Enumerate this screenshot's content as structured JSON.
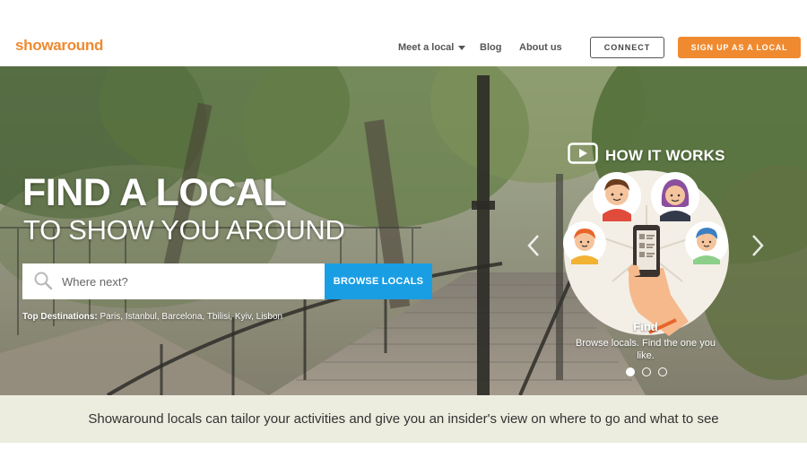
{
  "header": {
    "logo": "showaround",
    "nav": {
      "meet_label": "Meet a local",
      "blog_label": "Blog",
      "about_label": "About us"
    },
    "connect_label": "CONNECT",
    "signup_label": "SIGN UP AS A LOCAL"
  },
  "hero": {
    "title": "FIND A LOCAL",
    "subtitle": "TO SHOW YOU AROUND",
    "search": {
      "placeholder": "Where next?",
      "value": ""
    },
    "browse_label": "BROWSE LOCALS",
    "top_destinations": {
      "label": "Top Destinations:",
      "list": "Paris, Istanbul, Barcelona, Tbilisi, Kyiv, Lisbon"
    }
  },
  "how_it_works": {
    "title": "HOW IT WORKS",
    "step_title": "Find",
    "step_desc": "Browse locals. Find the one you like.",
    "dots": 3,
    "active_dot": 0
  },
  "tagline": "Showaround locals can tailor your activities and give you an insider's view on where to go and what to see",
  "colors": {
    "brand_orange": "#f08a30",
    "browse_blue": "#1a9ee3",
    "tagline_bg": "#ececdf"
  },
  "icons": {
    "nav_caret": "caret-down-icon",
    "search": "search-icon",
    "play": "play-icon",
    "prev": "chevron-left-icon",
    "next": "chevron-right-icon"
  }
}
